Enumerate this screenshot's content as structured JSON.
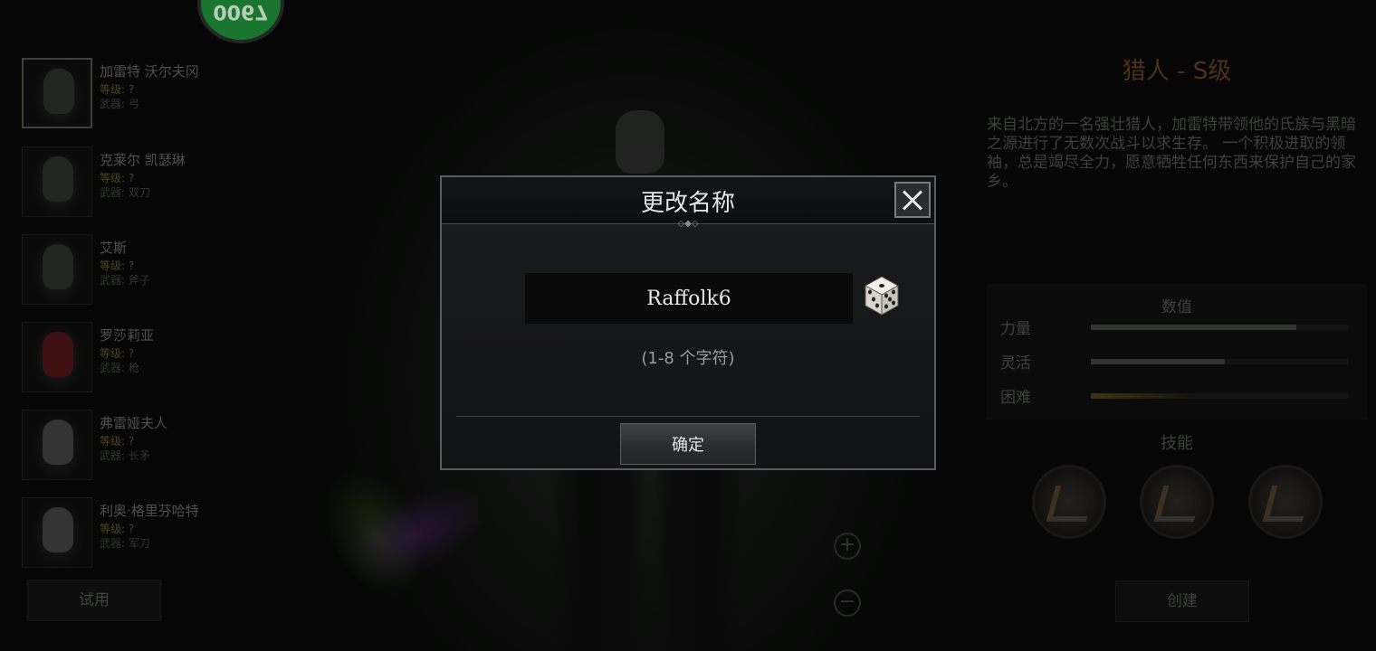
{
  "badge": {
    "text": "0067"
  },
  "characters": [
    {
      "name": "加雷特 沃尔夫冈",
      "level": "等级: ?",
      "weapon": "武器: 弓"
    },
    {
      "name": "克莱尔 凯瑟琳",
      "level": "等级: ?",
      "weapon": "武器: 双刀"
    },
    {
      "name": "艾斯",
      "level": "等级: ?",
      "weapon": "武器: 斧子"
    },
    {
      "name": "罗莎莉亚",
      "level": "等级: ?",
      "weapon": "武器: 枪"
    },
    {
      "name": "弗雷娅夫人",
      "level": "等级: ?",
      "weapon": "武器: 长矛"
    },
    {
      "name": "利奥·格里芬哈特",
      "level": "等级: ?",
      "weapon": "武器: 军刀"
    }
  ],
  "try_button": "试用",
  "zoom": {
    "in_icon": "zoom-in-icon",
    "out_icon": "zoom-out-icon"
  },
  "info": {
    "class_title": "猎人 - S级",
    "description": "来自北方的一名强壮猎人，加雷特带领他的氏族与黑暗之源进行了无数次战斗以求生存。 一个积极进取的领袖，总是竭尽全力，愿意牺牲任何东西来保护自己的家乡。",
    "stats_title": "数值",
    "stats": [
      {
        "label": "力量",
        "value": 0.8
      },
      {
        "label": "灵活",
        "value": 0.52
      },
      {
        "label": "困难",
        "value": 0.38
      }
    ],
    "skills_title": "技能",
    "create_button": "创建"
  },
  "modal": {
    "title": "更改名称",
    "name_value": "Raffolk6",
    "hint": "(1-8 个字符)",
    "confirm": "确定"
  }
}
